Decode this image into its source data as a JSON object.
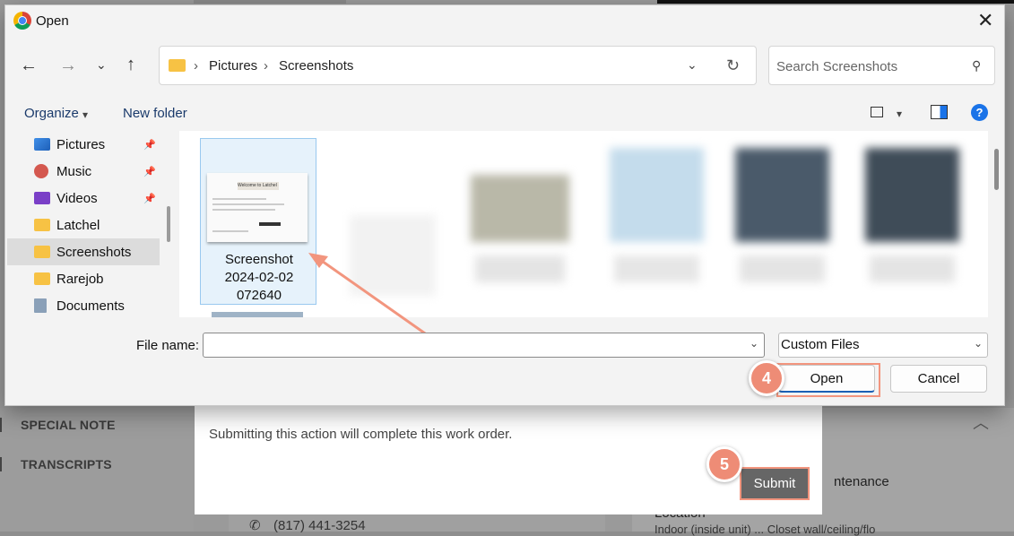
{
  "dialog": {
    "title": "Open",
    "breadcrumb": [
      "Pictures",
      "Screenshots"
    ],
    "search_placeholder": "Search Screenshots",
    "toolbar": {
      "organize": "Organize",
      "new_folder": "New folder"
    },
    "nav_items": [
      {
        "label": "Pictures",
        "pinned": true
      },
      {
        "label": "Music",
        "pinned": true
      },
      {
        "label": "Videos",
        "pinned": true
      },
      {
        "label": "Latchel",
        "pinned": false
      },
      {
        "label": "Screenshots",
        "pinned": false,
        "selected": true
      },
      {
        "label": "Rarejob",
        "pinned": false
      },
      {
        "label": "Documents",
        "pinned": false
      }
    ],
    "selected_file": {
      "line1": "Screenshot",
      "line2": "2024-02-02",
      "line3": "072640",
      "thumb_title": "Welcome to Latchel 👋"
    },
    "file_name_label": "File name:",
    "file_name_value": "",
    "file_type": "Custom Files",
    "open_button": "Open",
    "cancel_button": "Cancel"
  },
  "annotations": {
    "step4": "4",
    "step5": "5"
  },
  "background": {
    "menu": [
      "SPECIAL NOTE",
      "TRANSCRIPTS"
    ],
    "modal_text": "Submitting this action will complete this work order.",
    "submit_button": "Submit",
    "maintenance_text": "ntenance",
    "location_label": "Location",
    "location_text": "Indoor (inside unit) ... Closet wall/ceiling/flo",
    "phone": "(817) 441-3254"
  },
  "colors": {
    "highlight": "#f2957e",
    "badge": "#ee8c76",
    "help_blue": "#1a73e8"
  }
}
